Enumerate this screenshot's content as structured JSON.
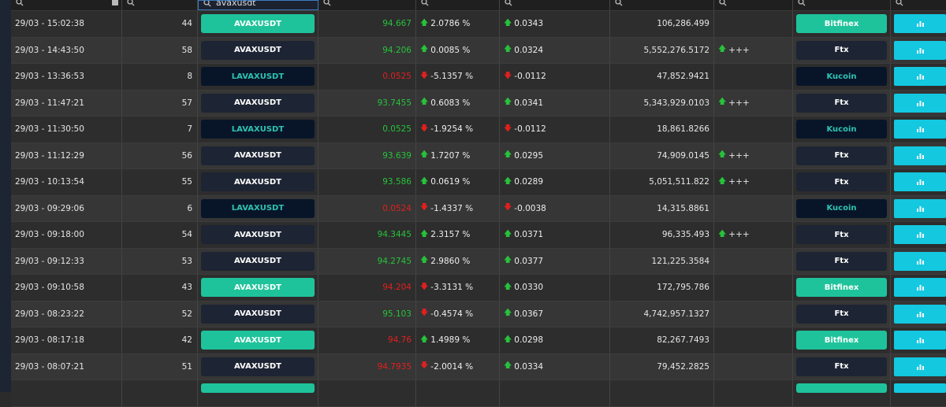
{
  "filters": {
    "pair_value": "avaxusdt"
  },
  "colors": {
    "green_pill": "#1fc39b",
    "dark_pill": "#1d2433",
    "darkest_pill": "#081528",
    "chart_button": "#14c8e0",
    "positive": "#26c33a",
    "negative": "#e0201e"
  },
  "rows": [
    {
      "time": "29/03 - 15:02:38",
      "num": "44",
      "pair": "AVAXUSDT",
      "pair_style": "green",
      "price": "94.667",
      "price_dir": "up",
      "pct": "2.0786 %",
      "pct_dir": "up",
      "delta": "0.0343",
      "delta_dir": "up",
      "volume": "106,286.499",
      "signal": "",
      "exchange": "Bitfinex",
      "exchange_style": "green"
    },
    {
      "time": "29/03 - 14:43:50",
      "num": "58",
      "pair": "AVAXUSDT",
      "pair_style": "dark",
      "price": "94.206",
      "price_dir": "up",
      "pct": "0.0085 %",
      "pct_dir": "up",
      "delta": "0.0324",
      "delta_dir": "up",
      "volume": "5,552,276.5172",
      "signal": "+++",
      "exchange": "Ftx",
      "exchange_style": "dark"
    },
    {
      "time": "29/03 - 13:36:53",
      "num": "8",
      "pair": "LAVAXUSDT",
      "pair_style": "darkest",
      "price": "0.0525",
      "price_dir": "down",
      "pct": "-5.1357 %",
      "pct_dir": "down",
      "delta": "-0.0112",
      "delta_dir": "down",
      "volume": "47,852.9421",
      "signal": "",
      "exchange": "Kucoin",
      "exchange_style": "darkest"
    },
    {
      "time": "29/03 - 11:47:21",
      "num": "57",
      "pair": "AVAXUSDT",
      "pair_style": "dark",
      "price": "93.7455",
      "price_dir": "up",
      "pct": "0.6083 %",
      "pct_dir": "up",
      "delta": "0.0341",
      "delta_dir": "up",
      "volume": "5,343,929.0103",
      "signal": "+++",
      "exchange": "Ftx",
      "exchange_style": "dark"
    },
    {
      "time": "29/03 - 11:30:50",
      "num": "7",
      "pair": "LAVAXUSDT",
      "pair_style": "darkest",
      "price": "0.0525",
      "price_dir": "up",
      "pct": "-1.9254 %",
      "pct_dir": "down",
      "delta": "-0.0112",
      "delta_dir": "down",
      "volume": "18,861.8266",
      "signal": "",
      "exchange": "Kucoin",
      "exchange_style": "darkest"
    },
    {
      "time": "29/03 - 11:12:29",
      "num": "56",
      "pair": "AVAXUSDT",
      "pair_style": "dark",
      "price": "93.639",
      "price_dir": "up",
      "pct": "1.7207 %",
      "pct_dir": "up",
      "delta": "0.0295",
      "delta_dir": "up",
      "volume": "74,909.0145",
      "signal": "+++",
      "exchange": "Ftx",
      "exchange_style": "dark"
    },
    {
      "time": "29/03 - 10:13:54",
      "num": "55",
      "pair": "AVAXUSDT",
      "pair_style": "dark",
      "price": "93.586",
      "price_dir": "up",
      "pct": "0.0619 %",
      "pct_dir": "up",
      "delta": "0.0289",
      "delta_dir": "up",
      "volume": "5,051,511.822",
      "signal": "+++",
      "exchange": "Ftx",
      "exchange_style": "dark"
    },
    {
      "time": "29/03 - 09:29:06",
      "num": "6",
      "pair": "LAVAXUSDT",
      "pair_style": "darkest",
      "price": "0.0524",
      "price_dir": "down",
      "pct": "-1.4337 %",
      "pct_dir": "down",
      "delta": "-0.0038",
      "delta_dir": "down",
      "volume": "14,315.8861",
      "signal": "",
      "exchange": "Kucoin",
      "exchange_style": "darkest"
    },
    {
      "time": "29/03 - 09:18:00",
      "num": "54",
      "pair": "AVAXUSDT",
      "pair_style": "dark",
      "price": "94.3445",
      "price_dir": "up",
      "pct": "2.3157 %",
      "pct_dir": "up",
      "delta": "0.0371",
      "delta_dir": "up",
      "volume": "96,335.493",
      "signal": "+++",
      "exchange": "Ftx",
      "exchange_style": "dark"
    },
    {
      "time": "29/03 - 09:12:33",
      "num": "53",
      "pair": "AVAXUSDT",
      "pair_style": "dark",
      "price": "94.2745",
      "price_dir": "up",
      "pct": "2.9860 %",
      "pct_dir": "up",
      "delta": "0.0377",
      "delta_dir": "up",
      "volume": "121,225.3584",
      "signal": "",
      "exchange": "Ftx",
      "exchange_style": "dark"
    },
    {
      "time": "29/03 - 09:10:58",
      "num": "43",
      "pair": "AVAXUSDT",
      "pair_style": "green",
      "price": "94.204",
      "price_dir": "down",
      "pct": "-3.3131 %",
      "pct_dir": "down",
      "delta": "0.0330",
      "delta_dir": "up",
      "volume": "172,795.786",
      "signal": "",
      "exchange": "Bitfinex",
      "exchange_style": "green"
    },
    {
      "time": "29/03 - 08:23:22",
      "num": "52",
      "pair": "AVAXUSDT",
      "pair_style": "dark",
      "price": "95.103",
      "price_dir": "up",
      "pct": "-0.4574 %",
      "pct_dir": "down",
      "delta": "0.0367",
      "delta_dir": "up",
      "volume": "4,742,957.1327",
      "signal": "",
      "exchange": "Ftx",
      "exchange_style": "dark"
    },
    {
      "time": "29/03 - 08:17:18",
      "num": "42",
      "pair": "AVAXUSDT",
      "pair_style": "green",
      "price": "94.76",
      "price_dir": "down",
      "pct": "1.4989 %",
      "pct_dir": "up",
      "delta": "0.0298",
      "delta_dir": "up",
      "volume": "82,267.7493",
      "signal": "",
      "exchange": "Bitfinex",
      "exchange_style": "green"
    },
    {
      "time": "29/03 - 08:07:21",
      "num": "51",
      "pair": "AVAXUSDT",
      "pair_style": "dark",
      "price": "94.7935",
      "price_dir": "down",
      "pct": "-2.0014 %",
      "pct_dir": "down",
      "delta": "0.0334",
      "delta_dir": "up",
      "volume": "79,452.2825",
      "signal": "",
      "exchange": "Ftx",
      "exchange_style": "dark"
    }
  ]
}
